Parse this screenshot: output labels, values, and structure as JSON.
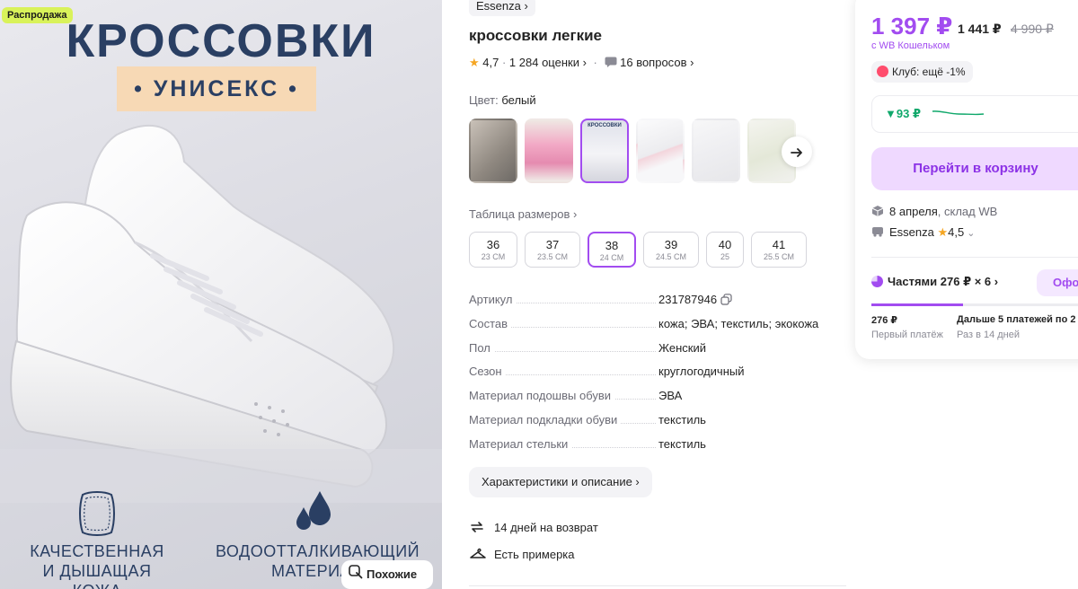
{
  "hero": {
    "sale_badge": "Распродажа",
    "title": "КРОССОВКИ",
    "subtitle": "• УНИСЕКС •",
    "feature1_line1": "КАЧЕСТВЕННАЯ",
    "feature1_line2": "И ДЫШАЩАЯ КОЖА",
    "feature2_line1": "ВОДООТТАЛКИВАЮЩИЙ",
    "feature2_line2": "МАТЕРИА",
    "similar_button": "Похожие",
    "thumb_caption": "КРОССОВКИ"
  },
  "product": {
    "brand": "Essenza ›",
    "title": "кроссовки легкие",
    "rating": "4,7",
    "rating_sep": " · ",
    "reviews": "1 284 оценки ›",
    "questions": "16 вопросов ›",
    "color_label": "Цвет:",
    "color_value": "белый",
    "size_table_link": "Таблица размеров ›",
    "sizes": [
      {
        "ru": "36",
        "cm": "23 СМ"
      },
      {
        "ru": "37",
        "cm": "23.5 СМ"
      },
      {
        "ru": "38",
        "cm": "24 СМ"
      },
      {
        "ru": "39",
        "cm": "24.5 СМ"
      },
      {
        "ru": "40",
        "cm": "25"
      },
      {
        "ru": "41",
        "cm": "25.5 СМ"
      }
    ],
    "specs": [
      {
        "k": "Артикул",
        "v": "231787946"
      },
      {
        "k": "Состав",
        "v": "кожа; ЭВА; текстиль; экокожа"
      },
      {
        "k": "Пол",
        "v": "Женский"
      },
      {
        "k": "Сезон",
        "v": "круглогодичный"
      },
      {
        "k": "Материал подошвы обуви",
        "v": "ЭВА"
      },
      {
        "k": "Материал подкладки обуви",
        "v": "текстиль"
      },
      {
        "k": "Материал стельки",
        "v": "текстиль"
      }
    ],
    "desc_button": "Характеристики и описание ›",
    "perk_return": "14 дней на возврат",
    "perk_fitting": "Есть примерка"
  },
  "buy": {
    "price": "1 397 ₽",
    "price_regular": "1 441 ₽",
    "price_old": "4 990 ₽",
    "wallet_note": "с WB Кошельком",
    "club": "Клуб: ещё -1%",
    "price_drop": "▼93 ₽",
    "cart_button": "Перейти в корзину",
    "delivery_date": "8 апреля",
    "delivery_where": ", склад WB",
    "seller": "Essenza",
    "seller_rating": "4,5",
    "installments": "Частями 276 ₽ × 6 ›",
    "installments_button": "Оформить",
    "installments_progress": 0.39,
    "pay1_amount": "276 ₽",
    "pay1_label": "Первый платёж",
    "pay2_amount": "Дальше 5 платежей по 2",
    "pay2_label": "Раз в 14 дней"
  },
  "colors": {
    "accent": "#a24cf0",
    "accent_light": "#efd9ff",
    "hero_text": "#2a3f63",
    "badge": "#d9f25a",
    "positive": "#10a86b"
  },
  "icons": [
    "search-icon",
    "star-icon",
    "question-icon",
    "arrow-right-icon",
    "copy-icon",
    "return-icon",
    "hanger-icon",
    "box-icon",
    "truck-icon",
    "leather-icon",
    "water-drops-icon"
  ]
}
